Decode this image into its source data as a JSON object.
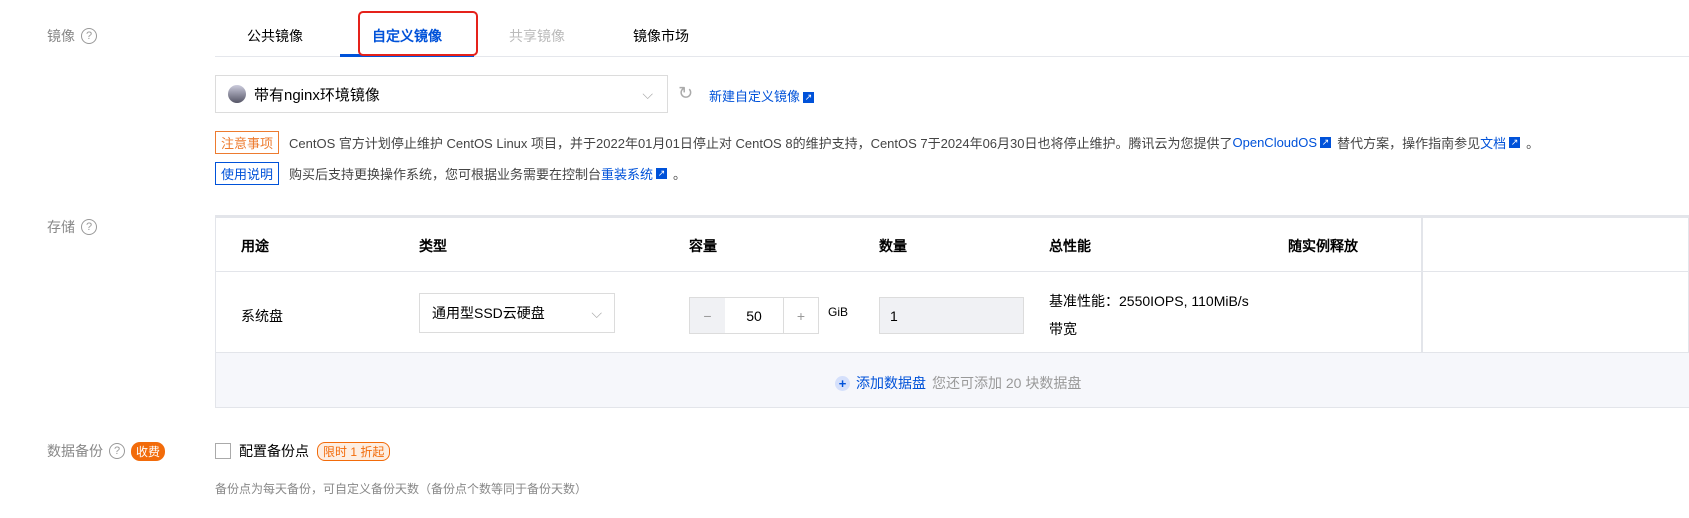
{
  "image": {
    "label": "镜像",
    "tabs": [
      "公共镜像",
      "自定义镜像",
      "共享镜像",
      "镜像市场"
    ],
    "selected": "带有nginx环境镜像",
    "new_link": "新建自定义镜像"
  },
  "notice": {
    "tag": "注意事项",
    "text": "CentOS 官方计划停止维护 CentOS Linux 项目，并于2022年01月01日停止对 CentOS 8的维护支持，CentOS 7于2024年06月30日也将停止维护。腾讯云为您提供了",
    "link1": "OpenCloudOS",
    "mid": "替代方案，操作指南参见",
    "link2": "文档",
    "end": "。"
  },
  "usage": {
    "tag": "使用说明",
    "text": "购买后支持更换操作系统，您可根据业务需要在控制台",
    "link": "重装系统",
    "end": "。"
  },
  "storage": {
    "label": "存储",
    "headers": [
      "用途",
      "类型",
      "容量",
      "数量",
      "总性能",
      "随实例释放"
    ],
    "row": {
      "use": "系统盘",
      "type": "通用型SSD云硬盘",
      "capacity": "50",
      "unit": "GiB",
      "quantity": "1",
      "perf1": "基准性能：2550IOPS, 110MiB/s",
      "perf2": "带宽"
    },
    "add": "添加数据盘",
    "add_hint": "您还可添加 20 块数据盘"
  },
  "backup": {
    "label": "数据备份",
    "fee": "收费",
    "checkbox": "配置备份点",
    "promo": "限时 1 折起",
    "hint": "备份点为每天备份，可自定义备份天数（备份点个数等同于备份天数）"
  }
}
